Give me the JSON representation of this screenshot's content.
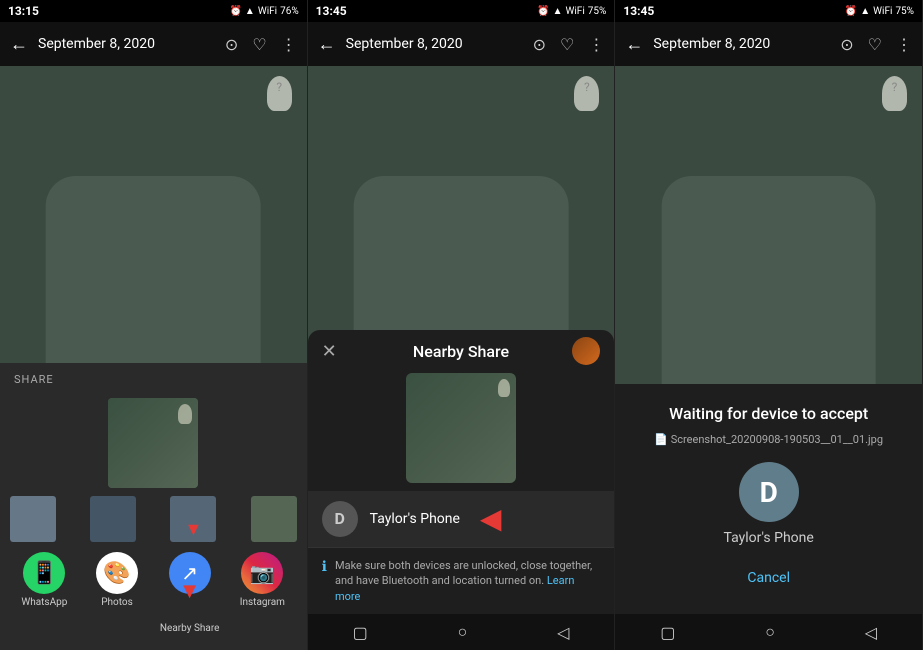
{
  "screens": [
    {
      "id": "screen1",
      "status_bar": {
        "time": "13:15",
        "icons": "📵 🔔 📶 🔋76%"
      },
      "top_bar": {
        "back": "←",
        "date": "September 8, 2020",
        "icons": [
          "⊙",
          "♡",
          "⋮"
        ]
      },
      "share_label": "SHARE",
      "app_items": [
        {
          "name": "WhatsApp",
          "color": "#25D366",
          "icon": "📱"
        },
        {
          "name": "Photos",
          "color": "#4285F4",
          "icon": "🖼"
        },
        {
          "name": "Nearby Share",
          "color": "#34A853",
          "icon": "↗"
        },
        {
          "name": "Instagram",
          "color": "#E1306C",
          "icon": "📸"
        }
      ],
      "nav": [
        "▢",
        "○",
        "◁"
      ]
    },
    {
      "id": "screen2",
      "status_bar": {
        "time": "13:45",
        "icons": "📵 🔔 📶 🔋75%"
      },
      "top_bar": {
        "back": "←",
        "date": "September 8, 2020",
        "icons": [
          "⊙",
          "♡",
          "⋮"
        ]
      },
      "nearby_share": {
        "title": "Nearby Share",
        "close": "✕",
        "device": {
          "initial": "D",
          "name": "Taylor's Phone"
        },
        "info_text": "Make sure both devices are unlocked, close together, and have Bluetooth and location turned on.",
        "info_link": "Learn more"
      },
      "nav": [
        "▢",
        "○",
        "◁"
      ]
    },
    {
      "id": "screen3",
      "status_bar": {
        "time": "13:45",
        "icons": "📵 🔔 📶 🔋75%"
      },
      "top_bar": {
        "back": "←",
        "date": "September 8, 2020",
        "icons": [
          "⊙",
          "♡",
          "⋮"
        ]
      },
      "waiting": {
        "title": "Waiting for device to accept",
        "filename": "Screenshot_20200908-190503__01__01.jpg",
        "device_initial": "D",
        "device_name": "Taylor's Phone",
        "cancel_label": "Cancel"
      },
      "nav": [
        "▢",
        "○",
        "◁"
      ]
    }
  ]
}
